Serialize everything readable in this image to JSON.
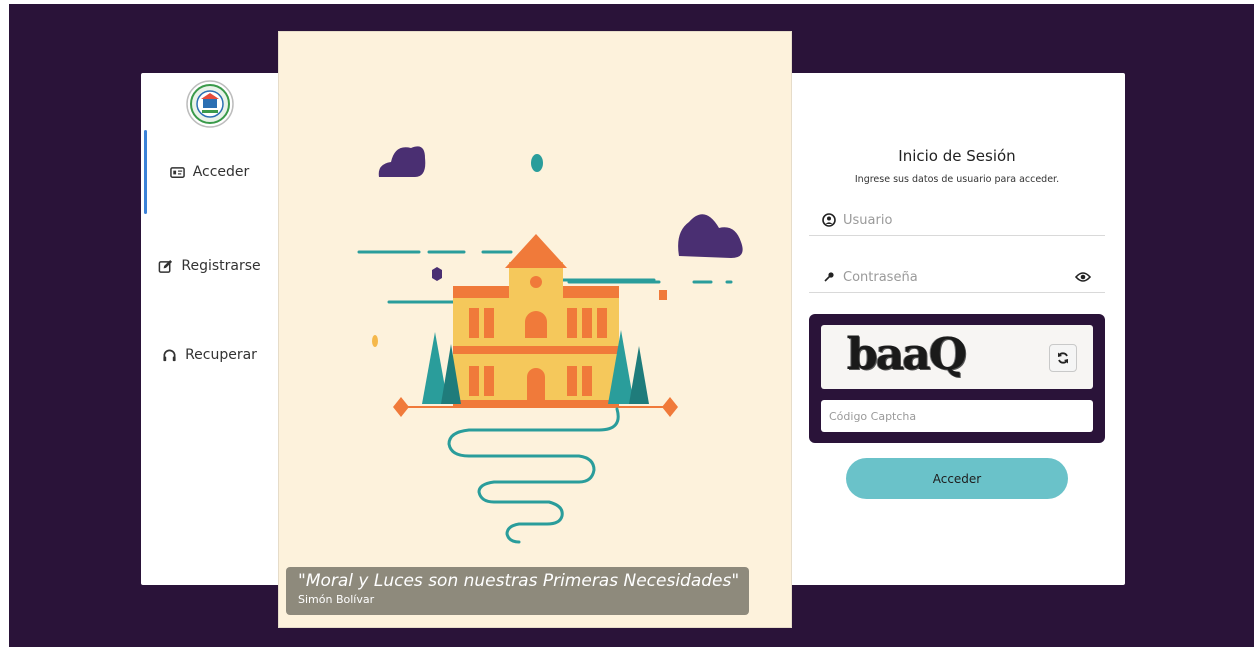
{
  "nav": {
    "items": [
      {
        "label": "Acceder",
        "icon": "id-card-icon",
        "active": true
      },
      {
        "label": "Registrarse",
        "icon": "edit-icon",
        "active": false
      },
      {
        "label": "Recuperar",
        "icon": "headset-icon",
        "active": false
      }
    ]
  },
  "illustration": {
    "quote": "\"Moral y Luces son nuestras Primeras Necesidades\"",
    "author": "Simón Bolívar"
  },
  "login": {
    "title": "Inicio de Sesión",
    "subtitle": "Ingrese sus datos de usuario para acceder.",
    "username_placeholder": "Usuario",
    "password_placeholder": "Contraseña",
    "captcha_text": "baaQ",
    "captcha_placeholder": "Código Captcha",
    "submit_label": "Acceder"
  },
  "colors": {
    "background": "#2a1339",
    "accent": "#6ac2c9",
    "active_indicator": "#3b82d8",
    "illustration_bg": "#fdf2dc"
  }
}
